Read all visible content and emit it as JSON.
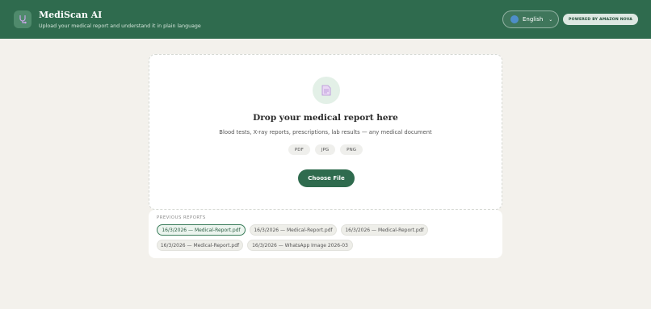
{
  "header": {
    "title": "MediScan AI",
    "subtitle": "Upload your medical report and understand it in plain language",
    "logo_icon": "stethoscope-icon",
    "language": "English",
    "powered_by": "POWERED BY AMAZON NOVA"
  },
  "upload": {
    "icon": "document-icon",
    "title": "Drop your medical report here",
    "subtitle": "Blood tests, X-ray reports, prescriptions, lab results — any medical document",
    "formats": [
      "PDF",
      "JPG",
      "PNG"
    ],
    "button_label": "Choose File"
  },
  "reports": {
    "label": "PREVIOUS REPORTS",
    "items": [
      {
        "label": "16/3/2026 — Medical-Report.pdf",
        "active": true
      },
      {
        "label": "16/3/2026 — Medical-Report.pdf",
        "active": false
      },
      {
        "label": "16/3/2026 — Medical-Report.pdf",
        "active": false
      },
      {
        "label": "16/3/2026 — Medical-Report.pdf",
        "active": false
      },
      {
        "label": "16/3/2026 — WhatsApp Image 2026-03",
        "active": false
      }
    ]
  },
  "colors": {
    "header_bg": "#2f6b4e",
    "accent": "#2f6b4e",
    "page_bg": "#f3f1ec"
  }
}
